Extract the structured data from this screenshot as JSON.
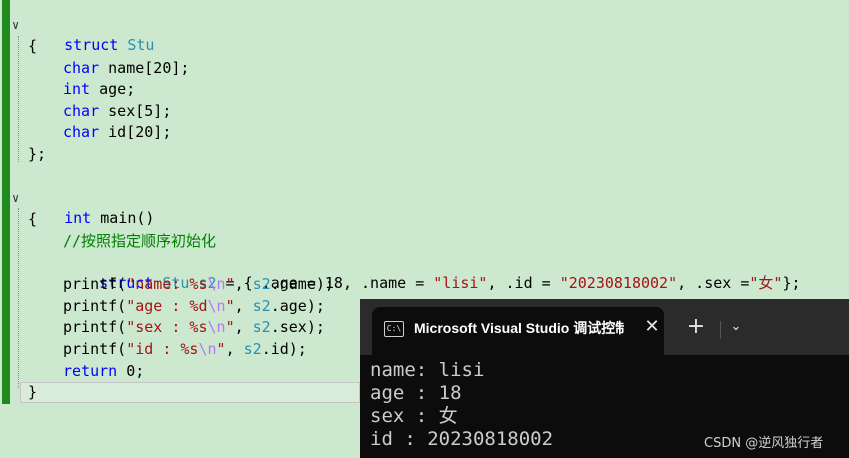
{
  "editor": {
    "struct_kw": "struct",
    "struct_name": "Stu",
    "open_brace_1": "{",
    "fields": [
      {
        "type": "char",
        "rest": " name[20];"
      },
      {
        "type": "int",
        "rest": " age;"
      },
      {
        "type": "char",
        "rest": " sex[5];"
      },
      {
        "type": "char",
        "rest": " id[20];"
      }
    ],
    "close_struct": "};",
    "main_kw": "int",
    "main_sig": " main()",
    "open_brace_2": "{",
    "comment": "//按照指定顺序初始化",
    "init_line": {
      "kw_struct": "struct",
      "type_stu": "Stu",
      "var_s2": "s2",
      "part1": " = { .age = 18, .name = ",
      "str_name": "\"lisi\"",
      "part2": ", .id = ",
      "str_id": "\"20230818002\"",
      "part3": ", .sex =",
      "str_sex": "\"女\"",
      "part4": "};"
    },
    "printf_lines": [
      {
        "fn": "printf(",
        "str_pre": "\"name: %s",
        "esc": "\\n",
        "str_end": "\"",
        "args_pre": ", ",
        "var": "s2",
        "args_post": ".name);"
      },
      {
        "fn": "printf(",
        "str_pre": "\"age : %d",
        "esc": "\\n",
        "str_end": "\"",
        "args_pre": ", ",
        "var": "s2",
        "args_post": ".age);"
      },
      {
        "fn": "printf(",
        "str_pre": "\"sex : %s",
        "esc": "\\n",
        "str_end": "\"",
        "args_pre": ", ",
        "var": "s2",
        "args_post": ".sex);"
      },
      {
        "fn": "printf(",
        "str_pre": "\"id : %s",
        "esc": "\\n",
        "str_end": "\"",
        "args_pre": ", ",
        "var": "s2",
        "args_post": ".id);"
      }
    ],
    "return_kw": "return",
    "return_rest": " 0;",
    "close_main": "}",
    "fold_glyph": "∨"
  },
  "terminal": {
    "tab_icon": "C:\\",
    "tab_title": "Microsoft Visual Studio 调试控制台",
    "close_glyph": "✕",
    "add_glyph": "+",
    "dropdown_glyph": "⌄",
    "output_lines": [
      "name: lisi",
      "age : 18",
      "sex : 女",
      "id : 20230818002"
    ]
  },
  "watermark": "CSDN @逆风独行者",
  "colors": {
    "editor_bg": "#cce8cf",
    "keyword": "#0000ff",
    "type": "#2b91af",
    "string": "#a31515",
    "comment": "#008000",
    "change_bar": "#1f8b1f",
    "terminal_bg": "#0c0c0c"
  }
}
